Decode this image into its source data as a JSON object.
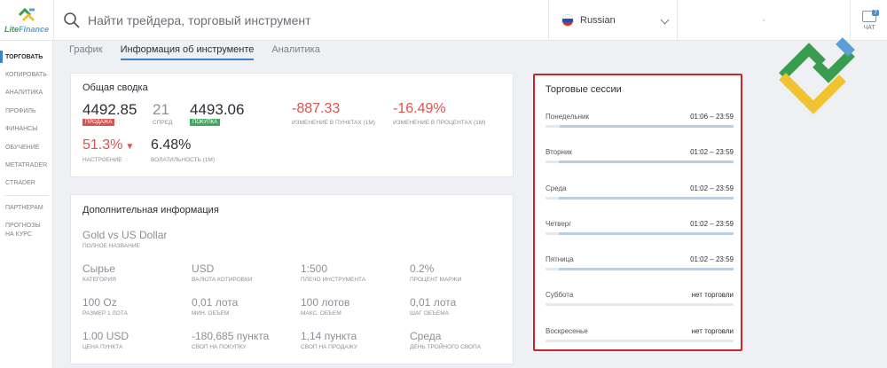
{
  "header": {
    "logo": {
      "text_a": "Lite",
      "text_b": "Finance"
    },
    "search": {
      "placeholder": "Найти трейдера, торговый инструмент"
    },
    "language": "Russian",
    "account": "·",
    "chat": {
      "badge": "7",
      "label": "ЧАТ"
    }
  },
  "sidebar": {
    "items": [
      {
        "label": "ТОРГОВАТЬ",
        "active": true
      },
      {
        "label": "КОПИРОВАТЬ"
      },
      {
        "label": "АНАЛИТИКА"
      },
      {
        "label": "ПРОФИЛЬ"
      },
      {
        "label": "ФИНАНСЫ"
      },
      {
        "label": "ОБУЧЕНИЕ"
      },
      {
        "label": "METATRADER"
      },
      {
        "label": "CTRADER"
      }
    ],
    "partners": "ПАРТНЕРАМ",
    "forecasts": "ПРОГНОЗЫ НА КУРС"
  },
  "tabs": [
    "График",
    "Информация об инструменте",
    "Аналитика"
  ],
  "summary": {
    "title": "Общая сводка",
    "sell": {
      "value": "4492.85",
      "label": "ПРОДАЖА"
    },
    "spread": {
      "value": "21",
      "label": "СПРЕД"
    },
    "buy": {
      "value": "4493.06",
      "label": "ПОКУПКА"
    },
    "change_points": {
      "value": "-887.33",
      "label": "ИЗМЕНЕНИЕ В ПУНКТАХ (1М)"
    },
    "change_percent": {
      "value": "-16.49%",
      "label": "ИЗМЕНЕНИЕ В ПРОЦЕНТАХ (1М)"
    },
    "sentiment": {
      "value": "51.3%",
      "arrow": "▼",
      "label": "НАСТРОЕНИЕ"
    },
    "volatility": {
      "value": "6.48%",
      "label": "ВОЛАТИЛЬНОСТЬ (1М)"
    }
  },
  "details": {
    "title": "Дополнительная информация",
    "full_name": {
      "value": "Gold vs US Dollar",
      "label": "ПОЛНОЕ НАЗВАНИЕ"
    },
    "rows": [
      [
        {
          "value": "Сырье",
          "label": "КАТЕГОРИЯ"
        },
        {
          "value": "USD",
          "label": "ВАЛЮТА КОТИРОВКИ"
        },
        {
          "value": "1:500",
          "label": "ПЛЕЧО ИНСТРУМЕНТА"
        },
        {
          "value": "0.2%",
          "label": "ПРОЦЕНТ МАРЖИ"
        }
      ],
      [
        {
          "value": "100 Oz",
          "label": "РАЗМЕР 1 ЛОТА"
        },
        {
          "value": "0,01 лота",
          "label": "МИН. ОБЪЕМ"
        },
        {
          "value": "100 лотов",
          "label": "МАКС. ОБЪЕМ"
        },
        {
          "value": "0,01 лота",
          "label": "ШАГ ОБЪЕМА"
        }
      ],
      [
        {
          "value": "1.00 USD",
          "label": "ЦЕНА ПУНКТА"
        },
        {
          "value": "-180,685 пункта",
          "label": "СВОП НА ПОКУПКУ"
        },
        {
          "value": "1,14 пункта",
          "label": "СВОП НА ПРОДАЖУ"
        },
        {
          "value": "Среда",
          "label": "ДЕНЬ ТРОЙНОГО СВОПА"
        }
      ]
    ]
  },
  "sessions": {
    "title": "Торговые сессии",
    "days": [
      {
        "day": "Понедельник",
        "time": "01:06 – 23:59",
        "start": 0.074,
        "end": 1.0
      },
      {
        "day": "Вторник",
        "time": "01:02 – 23:59",
        "start": 0.071,
        "end": 1.0
      },
      {
        "day": "Среда",
        "time": "01:02 – 23:59",
        "start": 0.071,
        "end": 1.0
      },
      {
        "day": "Четверг",
        "time": "01:02 – 23:59",
        "start": 0.071,
        "end": 1.0
      },
      {
        "day": "Пятница",
        "time": "01:02 – 23:59",
        "start": 0.071,
        "end": 1.0
      },
      {
        "day": "Суббота",
        "time": "нет торговли",
        "start": 0,
        "end": 0
      },
      {
        "day": "Воскресенье",
        "time": "нет торговли",
        "start": 0,
        "end": 0
      }
    ]
  },
  "colors": {
    "accent": "#3a82c9",
    "sell_tag": "#d9534f",
    "buy_tag": "#3daa5c",
    "negative": "#d9534f",
    "highlight_border": "#c8262c"
  }
}
